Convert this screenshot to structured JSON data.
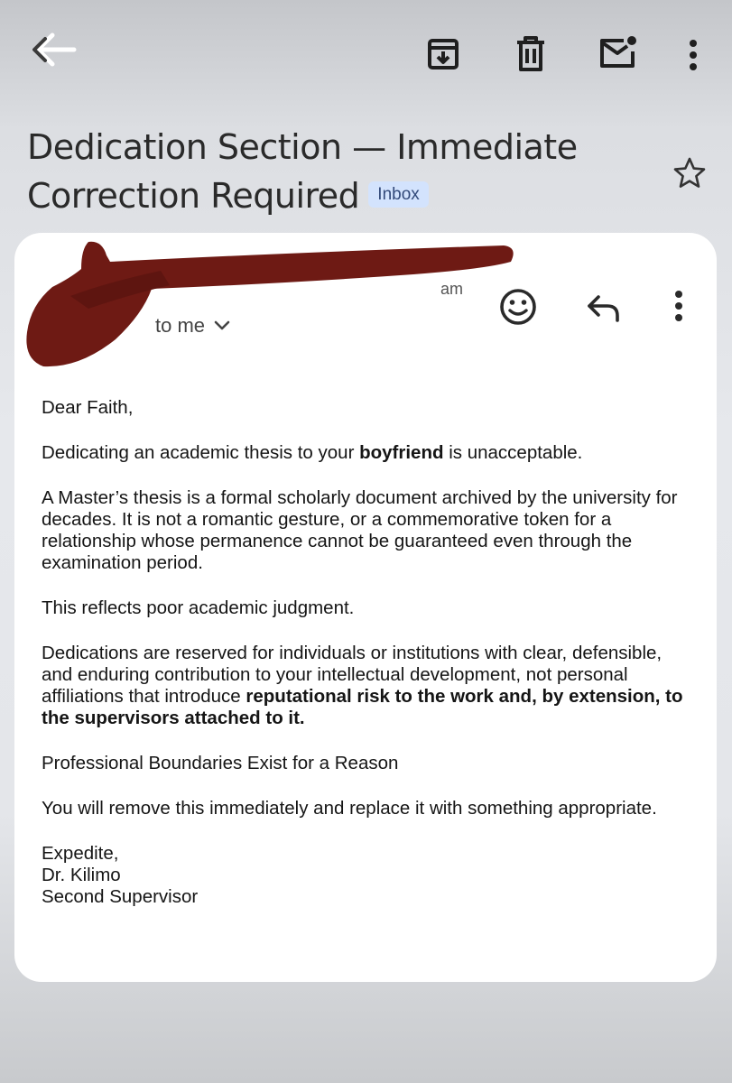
{
  "toolbar": {
    "back_icon": "arrow-back-icon",
    "archive_icon": "archive-icon",
    "delete_icon": "trash-icon",
    "mark_unread_icon": "mail-unread-icon",
    "more_icon": "more-vert-icon"
  },
  "email": {
    "subject_line1": "Dedication Section — Immediate",
    "subject_line2": "Correction Required",
    "label_chip": "Inbox",
    "star_icon": "star-outline-icon",
    "sender_time_fragment": "am",
    "recipient": "to me",
    "chevron_icon": "chevron-down-icon",
    "emoji_icon": "emoji-react-icon",
    "reply_icon": "reply-icon",
    "more_icon": "more-vert-icon",
    "greeting": "Dear Faith,",
    "p1_before": "Dedicating an academic thesis to your ",
    "p1_bold": "boyfriend",
    "p1_after": " is unacceptable.",
    "p2": "A Master’s thesis is a formal scholarly document archived by the university for decades. It is not a romantic gesture, or a commemorative token for a relationship whose permanence cannot be guaranteed even through the examination period.",
    "p3": "This reflects poor academic judgment.",
    "p4_before": "Dedications are reserved for individuals or institutions with clear, defensible, and enduring contribution to your intellectual development, not personal affiliations that introduce ",
    "p4_bold": "reputational risk to the work and, by extension, to the supervisors attached to it.",
    "p5": "Professional Boundaries Exist for a Reason",
    "p6": "You will remove this immediately and replace it with something appropriate.",
    "signoff": "Expedite,",
    "sender_name": "Dr. Kilimo",
    "sender_title": "Second Supervisor"
  },
  "colors": {
    "redaction": "#6e1a14",
    "chip_bg": "#d3e3fd",
    "chip_text": "#334a7a",
    "card_bg": "#ffffff"
  }
}
